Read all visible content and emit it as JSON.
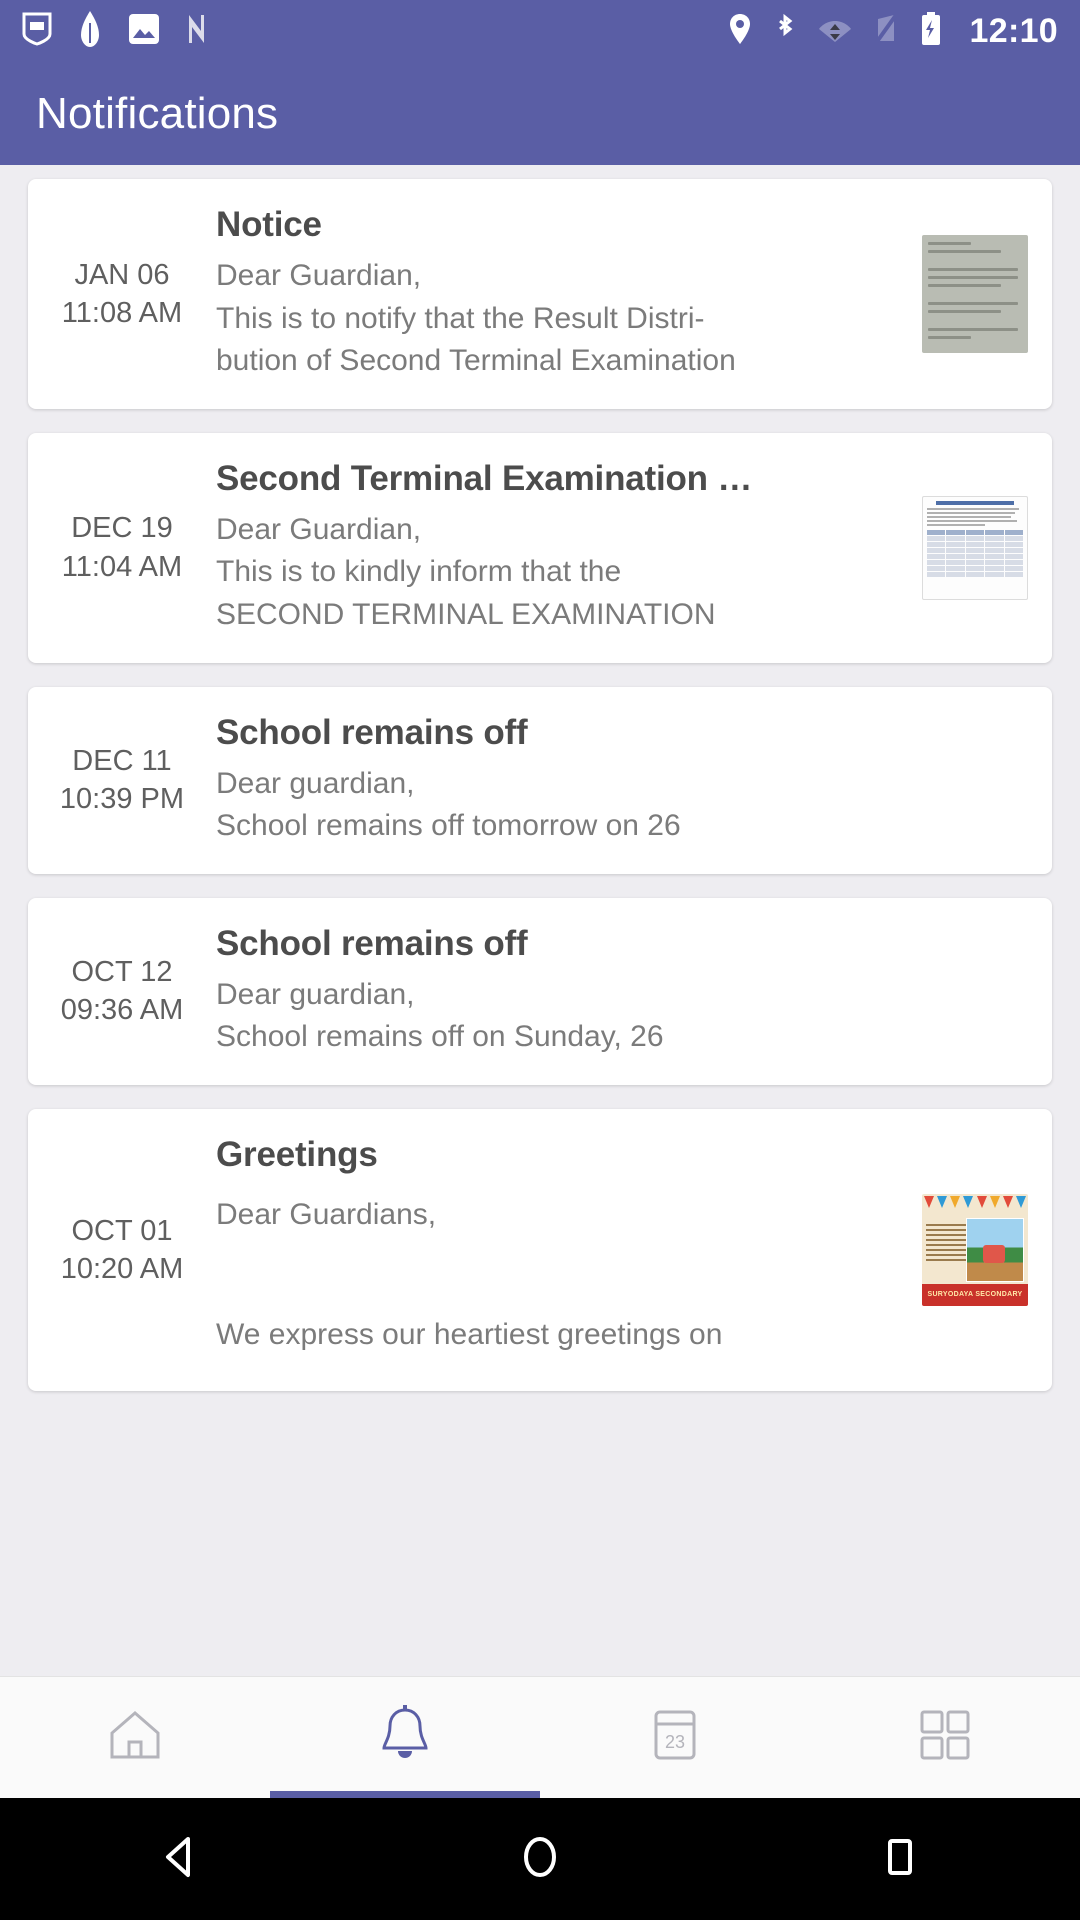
{
  "statusbar": {
    "time": "12:10",
    "left_icons": [
      "school-crest-icon",
      "pen-nib-icon",
      "photo-icon",
      "nova-launcher-icon"
    ],
    "right_icons": [
      "location-icon",
      "bluetooth-icon",
      "wifi-icon",
      "signal-off-icon",
      "battery-charging-icon"
    ]
  },
  "appbar": {
    "title": "Notifications"
  },
  "notifications": [
    {
      "date": "JAN 06",
      "time": "11:08 AM",
      "title": "Notice",
      "body": "Dear Guardian,\nThis is to notify that the Result Distri-\nbution of Second Terminal Examination",
      "thumb": "scanned-notice-letter"
    },
    {
      "date": "DEC 19",
      "time": "11:04 AM",
      "title": "Second Terminal Examination …",
      "body": "Dear Guardian,\nThis is to kindly inform that the\nSECOND TERMINAL EXAMINATION",
      "thumb": "exam-routine-table"
    },
    {
      "date": "DEC 11",
      "time": "10:39 PM",
      "title": "School remains off",
      "body": "Dear guardian,\nSchool remains off tomorrow on 26",
      "thumb": ""
    },
    {
      "date": "OCT 12",
      "time": "09:36 AM",
      "title": "School remains off",
      "body": "Dear guardian,\nSchool remains off on Sunday, 26",
      "thumb": ""
    },
    {
      "date": "OCT 01",
      "time": "10:20 AM",
      "title": "Greetings",
      "body": "Dear Guardians,\n\nWe express our heartiest greetings on",
      "thumb": "greeting-card-image",
      "thumb_caption": "SURYODAYA SECONDARY"
    }
  ],
  "bottom_nav": {
    "items": [
      {
        "name": "home",
        "icon": "home-icon",
        "active": false
      },
      {
        "name": "notifications",
        "icon": "bell-icon",
        "active": true
      },
      {
        "name": "calendar",
        "icon": "calendar-icon",
        "day": "23",
        "active": false
      },
      {
        "name": "more",
        "icon": "grid-icon",
        "active": false
      }
    ]
  },
  "android_nav": {
    "back": "back-triangle-icon",
    "home": "home-circle-icon",
    "recents": "recents-square-icon"
  },
  "colors": {
    "brand": "#5a5ea5",
    "background": "#eeedf1",
    "card": "#ffffff",
    "title_text": "#4c4c4c",
    "body_text": "#7b7b7b"
  }
}
